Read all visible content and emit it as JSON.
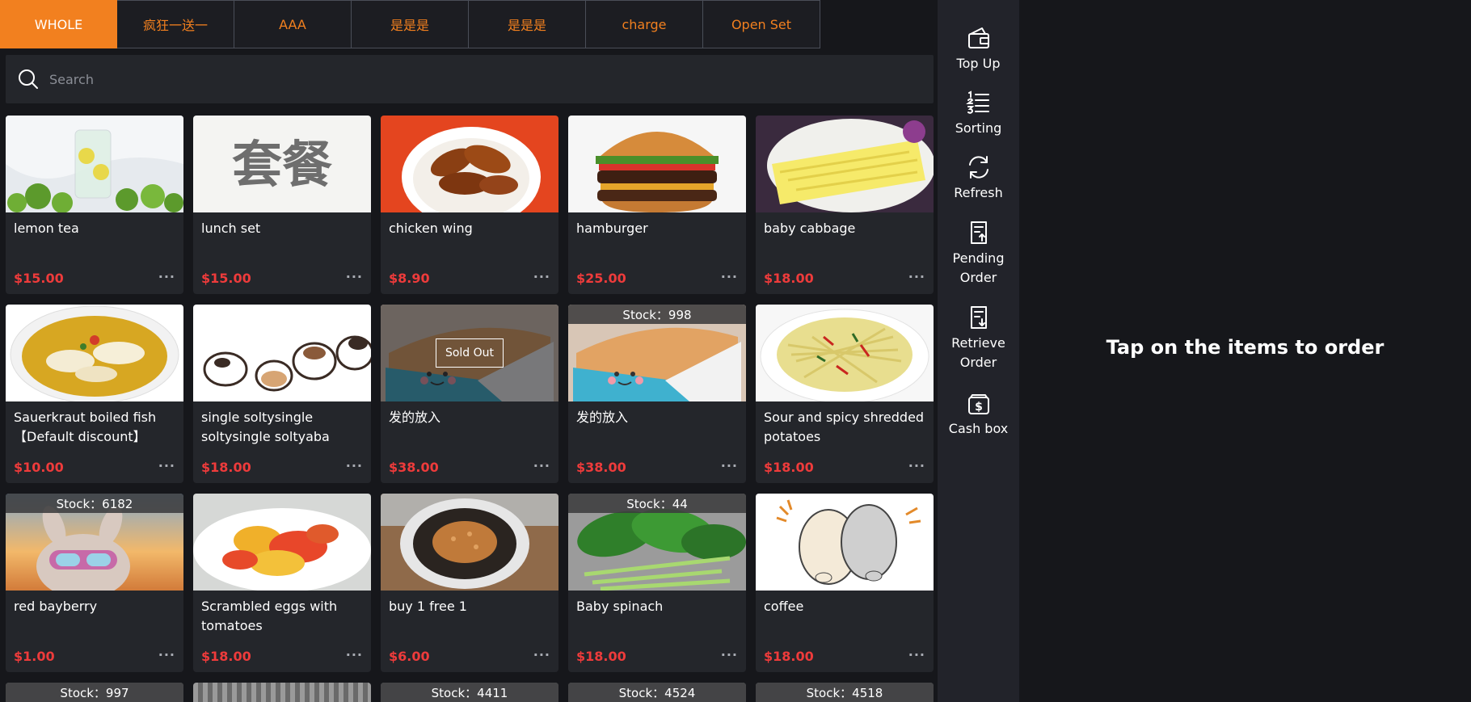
{
  "categories": {
    "tabs": [
      {
        "label": "WHOLE",
        "active": true
      },
      {
        "label": "疯狂一送一",
        "active": false
      },
      {
        "label": "AAA",
        "active": false
      },
      {
        "label": "是是是",
        "active": false
      },
      {
        "label": "是是是",
        "active": false
      },
      {
        "label": "charge",
        "active": false
      },
      {
        "label": "Open Set",
        "active": false
      }
    ]
  },
  "search": {
    "placeholder": "Search",
    "icon": "search-icon"
  },
  "products": [
    {
      "name": "lemon tea",
      "price": "$15.00",
      "more": "···",
      "art": "lemon-tea"
    },
    {
      "name": "lunch set",
      "price": "$15.00",
      "more": "···",
      "art": "lunch-set",
      "art_text": "套餐"
    },
    {
      "name": "chicken wing",
      "price": "$8.90",
      "more": "···",
      "art": "chicken-wing"
    },
    {
      "name": "hamburger",
      "price": "$25.00",
      "more": "···",
      "art": "hamburger"
    },
    {
      "name": "baby cabbage",
      "price": "$18.00",
      "more": "···",
      "art": "baby-cabbage"
    },
    {
      "name": "Sauerkraut boiled fish【Default discount】",
      "price": "$10.00",
      "more": "···",
      "art": "fish"
    },
    {
      "name": "single soltysingle soltysingle soltyaba",
      "price": "$18.00",
      "more": "···",
      "art": "dogs"
    },
    {
      "name": "发的放入",
      "price": "$38.00",
      "more": "···",
      "art": "cake",
      "sold_out": "Sold Out"
    },
    {
      "name": "发的放入",
      "price": "$38.00",
      "more": "···",
      "art": "cake",
      "stock": "Stock：998"
    },
    {
      "name": "Sour and spicy shredded potatoes",
      "price": "$18.00",
      "more": "···",
      "art": "potatoes"
    },
    {
      "name": "red bayberry",
      "price": "$1.00",
      "more": "···",
      "art": "bunny",
      "stock": "Stock：6182"
    },
    {
      "name": "Scrambled eggs with tomatoes",
      "price": "$18.00",
      "more": "···",
      "art": "eggs"
    },
    {
      "name": "buy 1 free 1",
      "price": "$6.00",
      "more": "···",
      "art": "bowl"
    },
    {
      "name": "Baby spinach",
      "price": "$18.00",
      "more": "···",
      "art": "spinach",
      "stock": "Stock：44"
    },
    {
      "name": "coffee",
      "price": "$18.00",
      "more": "···",
      "art": "cats"
    }
  ],
  "partial_row": [
    {
      "stock": "Stock：997"
    },
    {
      "stock": ""
    },
    {
      "stock": "Stock：4411"
    },
    {
      "stock": "Stock：4524"
    },
    {
      "stock": "Stock：4518"
    }
  ],
  "sidebar": {
    "items": [
      {
        "label": "Top Up",
        "icon": "wallet-icon"
      },
      {
        "label": "Sorting",
        "icon": "list-sort-icon"
      },
      {
        "label": "Refresh",
        "icon": "refresh-icon"
      },
      {
        "label": "Pending\nOrder",
        "icon": "pending-order-icon"
      },
      {
        "label": "Retrieve\nOrder",
        "icon": "retrieve-order-icon"
      },
      {
        "label": "Cash box",
        "icon": "cash-box-icon"
      }
    ]
  },
  "order": {
    "hint": "Tap on the items to order"
  },
  "colors": {
    "accent": "#f2801f",
    "price": "#ee3b3b",
    "panel": "#24262b",
    "background": "#16171b"
  }
}
